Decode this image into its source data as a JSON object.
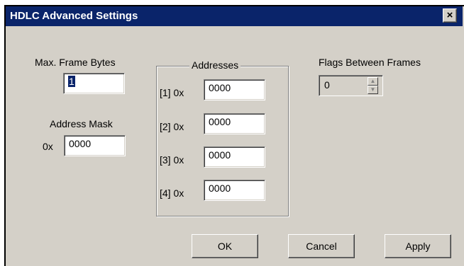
{
  "window": {
    "title": "HDLC Advanced Settings",
    "close_glyph": "×"
  },
  "max_frame": {
    "label": "Max. Frame Bytes",
    "value": "1"
  },
  "address_mask": {
    "label": "Address Mask",
    "prefix": "0x",
    "value": "0000"
  },
  "addresses": {
    "group_label": "Addresses",
    "items": [
      {
        "label": "[1] 0x",
        "value": "0000"
      },
      {
        "label": "[2] 0x",
        "value": "0000"
      },
      {
        "label": "[3] 0x",
        "value": "0000"
      },
      {
        "label": "[4] 0x",
        "value": "0000"
      }
    ]
  },
  "flags": {
    "label": "Flags Between Frames",
    "value": "0",
    "up_icon": "▲",
    "down_icon": "▼"
  },
  "buttons": {
    "ok": "OK",
    "cancel": "Cancel",
    "apply": "Apply"
  },
  "colors": {
    "titlebar": "#0a246a",
    "face": "#d4d0c8"
  }
}
